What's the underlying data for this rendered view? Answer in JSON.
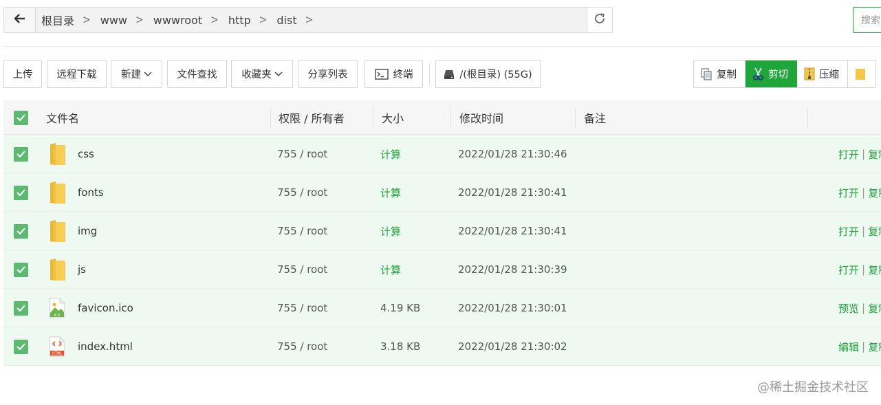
{
  "breadcrumbs": [
    "根目录",
    "www",
    "wwwroot",
    "http",
    "dist"
  ],
  "search": {
    "placeholder": "搜索"
  },
  "toolbar": {
    "upload": "上传",
    "remote_download": "远程下载",
    "new": "新建",
    "file_search": "文件查找",
    "favorites": "收藏夹",
    "share_list": "分享列表",
    "terminal": "终端",
    "disk": "/(根目录) (55G)"
  },
  "clip_group": {
    "copy": "复制",
    "cut": "剪切",
    "compress": "压缩"
  },
  "table": {
    "headers": {
      "name": "文件名",
      "perm": "权限 / 所有者",
      "size": "大小",
      "mtime": "修改时间",
      "note": "备注"
    },
    "rows": [
      {
        "name": "css",
        "type": "folder",
        "perm": "755 / root",
        "size": "计算",
        "mtime": "2022/01/28 21:30:46",
        "op1": "打开",
        "op2": "复制"
      },
      {
        "name": "fonts",
        "type": "folder",
        "perm": "755 / root",
        "size": "计算",
        "mtime": "2022/01/28 21:30:41",
        "op1": "打开",
        "op2": "复制"
      },
      {
        "name": "img",
        "type": "folder",
        "perm": "755 / root",
        "size": "计算",
        "mtime": "2022/01/28 21:30:41",
        "op1": "打开",
        "op2": "复制"
      },
      {
        "name": "js",
        "type": "folder",
        "perm": "755 / root",
        "size": "计算",
        "mtime": "2022/01/28 21:30:39",
        "op1": "打开",
        "op2": "复制"
      },
      {
        "name": "favicon.ico",
        "type": "ico",
        "perm": "755 / root",
        "size": "4.19 KB",
        "mtime": "2022/01/28 21:30:01",
        "op1": "预览",
        "op2": "复制"
      },
      {
        "name": "index.html",
        "type": "html",
        "perm": "755 / root",
        "size": "3.18 KB",
        "mtime": "2022/01/28 21:30:02",
        "op1": "编辑",
        "op2": "复制"
      }
    ]
  },
  "watermark": "@稀土掘金技术社区",
  "colors": {
    "accent": "#20a53a",
    "row_selected": "#eef9f1",
    "checkbox": "#5db872"
  }
}
